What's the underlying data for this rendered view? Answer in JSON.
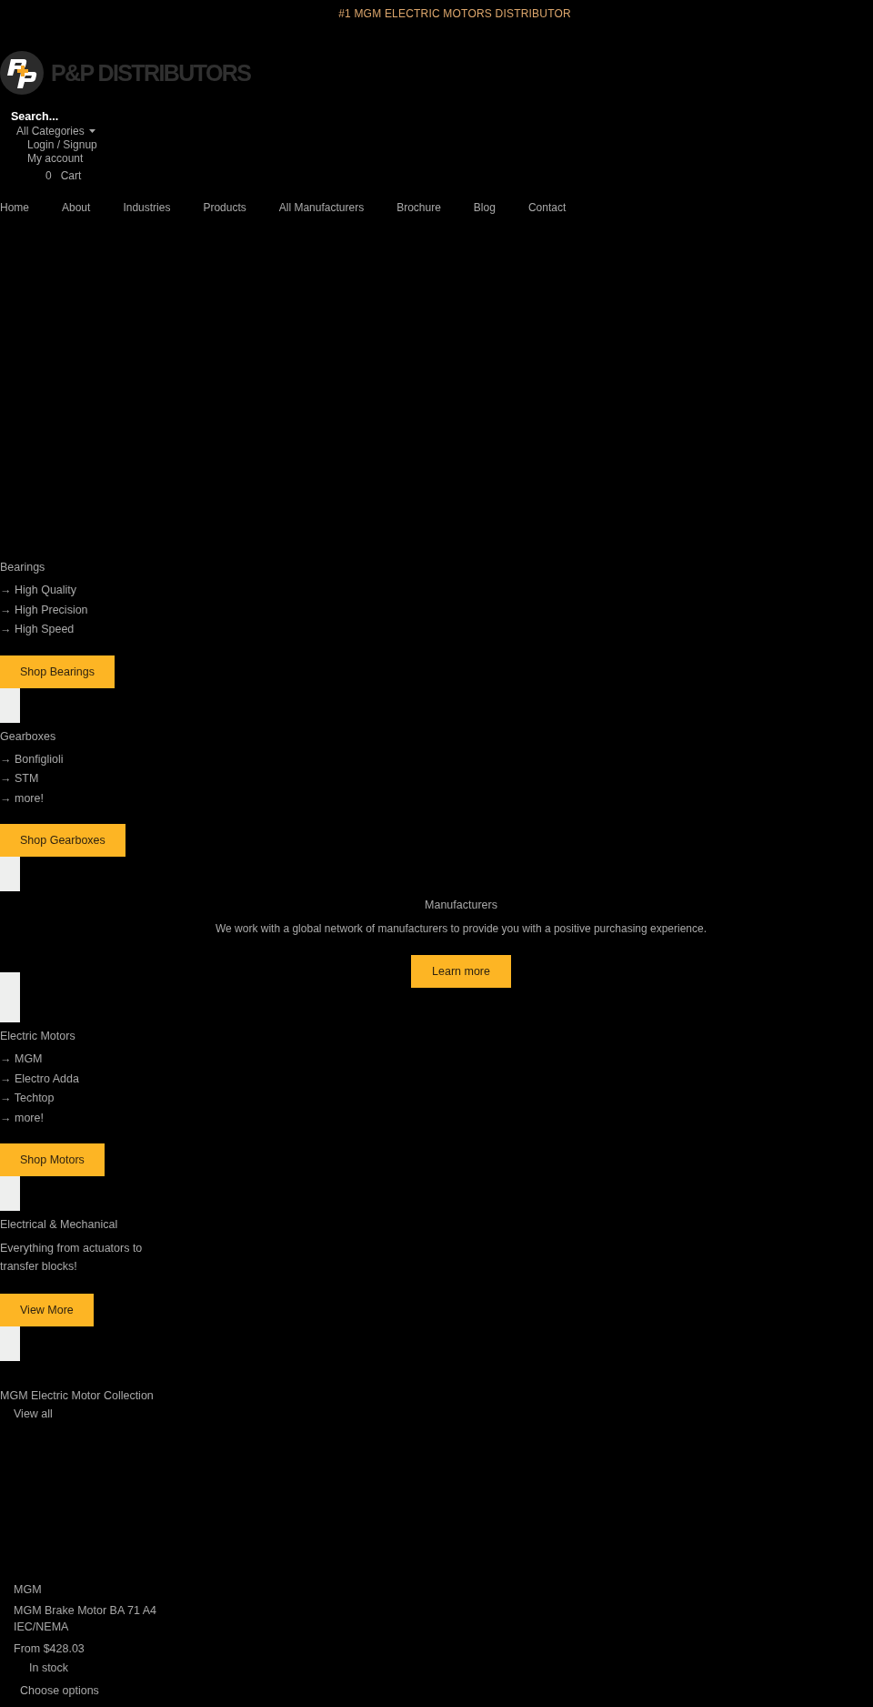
{
  "announcement": "#1 MGM ELECTRIC MOTORS DISTRIBUTOR",
  "header": {
    "logo_text": "P&P DISTRIBUTORS",
    "search": {
      "placeholder": "Search..."
    },
    "category_select": {
      "value": "All Categories"
    },
    "login": "Login / Signup",
    "account": "My account",
    "cart": {
      "count": "0",
      "label": "Cart"
    }
  },
  "nav": [
    "Home",
    "About",
    "Industries",
    "Products",
    "All Manufacturers",
    "Brochure",
    "Blog",
    "Contact"
  ],
  "sections": [
    {
      "kind": "category",
      "heading": "Bearings",
      "items": [
        "→ High Quality",
        "→ High Precision",
        "→ High Speed"
      ],
      "button": "Shop Bearings"
    },
    {
      "kind": "category",
      "heading": "Gearboxes",
      "items": [
        "→ Bonfiglioli",
        "→ STM",
        "→ more!"
      ],
      "button": "Shop Gearboxes"
    },
    {
      "kind": "banner",
      "heading": "Manufacturers",
      "text": "We work with a global network of manufacturers to provide you with a positive purchasing experience.",
      "button": "Learn more"
    },
    {
      "kind": "category",
      "heading": "Electric Motors",
      "items": [
        "→ MGM",
        "→ Electro Adda",
        "→ Techtop",
        "→ more!"
      ],
      "button": "Shop Motors"
    },
    {
      "kind": "text",
      "heading": "Electrical & Mechanical",
      "text": "Everything from actuators to transfer blocks!",
      "button": "View More"
    }
  ],
  "collection": {
    "title": "MGM Electric Motor Collection",
    "link": "View all",
    "products": [
      {
        "vendor": "MGM",
        "title": "MGM Brake Motor BA 71 A4 IEC/NEMA",
        "price": "From $428.03",
        "stock": "In stock",
        "action": "Choose options"
      }
    ]
  }
}
